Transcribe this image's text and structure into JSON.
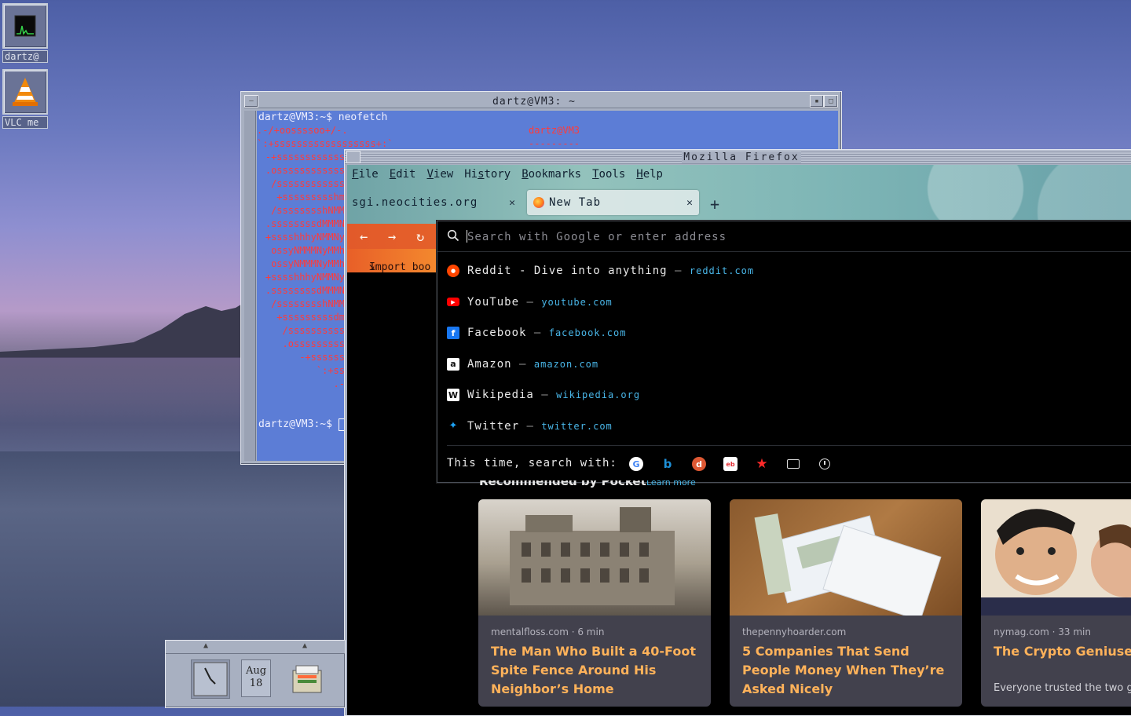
{
  "desktop": {
    "icons": [
      {
        "label": "dartz@",
        "icon": "system-monitor-icon"
      },
      {
        "label": "VLC me",
        "icon": "vlc-cone-icon"
      }
    ]
  },
  "terminal": {
    "title": "dartz@VM3: ~",
    "line1": "dartz@VM3:~$ neofetch",
    "user_host": "dartz@VM3",
    "underline": "---------",
    "last_prompt": "dartz@VM3:~$ ",
    "art": [
      ".-/+oossssoo+/-.",
      "`:+ssssssssssssssssss+:`",
      "-+ssssssssssss",
      ".ossssssssssss",
      "/ssssssssssss",
      "+ssssssssshm",
      "/sssssssshNMM",
      ".ssssssssdMMMN",
      "+sssshhhyNMMNy",
      "ossyNMMMNyMMh",
      "ossyNMMMNyMMh",
      "+sssshhhyNMMNy",
      ".ssssssssdMMMN",
      "/sssssssshNMM",
      "+sssssssssdm",
      "/ssssssssss",
      ".osssssssss",
      "-+ssssss",
      "`:+ss",
      ".-"
    ]
  },
  "firefox": {
    "title": "Mozilla Firefox",
    "menu": [
      {
        "label": "File",
        "u": "F",
        "rest": "ile"
      },
      {
        "label": "Edit",
        "u": "E",
        "rest": "dit"
      },
      {
        "label": "View",
        "u": "V",
        "rest": "iew"
      },
      {
        "label": "History",
        "pre": "Hi",
        "u": "s",
        "rest": "tory"
      },
      {
        "label": "Bookmarks",
        "u": "B",
        "rest": "ookmarks"
      },
      {
        "label": "Tools",
        "u": "T",
        "rest": "ools"
      },
      {
        "label": "Help",
        "u": "H",
        "rest": "elp"
      }
    ],
    "tabs": [
      {
        "label": "sgi.neocities.org",
        "active": false
      },
      {
        "label": "New Tab",
        "active": true
      }
    ],
    "import_bookmarks": "Import boo",
    "url": {
      "placeholder": "Search with Google or enter address",
      "value": ""
    },
    "suggestions": [
      {
        "title": "Reddit - Dive into anything",
        "url": "reddit.com",
        "icon": "reddit-icon",
        "color": "#ff4500"
      },
      {
        "title": "YouTube",
        "url": "youtube.com",
        "icon": "youtube-icon",
        "color": "#ff0000"
      },
      {
        "title": "Facebook",
        "url": "facebook.com",
        "icon": "facebook-icon",
        "color": "#1877f2"
      },
      {
        "title": "Amazon",
        "url": "amazon.com",
        "icon": "amazon-icon",
        "color": "#ffffff"
      },
      {
        "title": "Wikipedia",
        "url": "wikipedia.org",
        "icon": "wikipedia-icon",
        "color": "#ffffff"
      },
      {
        "title": "Twitter",
        "url": "twitter.com",
        "icon": "twitter-icon",
        "color": "#1da1f2"
      }
    ],
    "search_with_label": "This time, search with:",
    "engines": [
      "google-icon",
      "bing-icon",
      "duckduckgo-icon",
      "ebay-icon",
      "bookmarks-star-icon",
      "tabs-icon",
      "history-icon"
    ],
    "pocket": {
      "heading": "Recommended by Pocket",
      "learn_more": "Learn more",
      "cards": [
        {
          "source": "mentalfloss.com · 6 min",
          "title": "The Man Who Built a 40-Foot Spite Fence Around His Neighbor’s Home",
          "excerpt": ""
        },
        {
          "source": "thepennyhoarder.com",
          "title": "5 Companies That Send People Money When They’re Asked Nicely",
          "excerpt": ""
        },
        {
          "source": "nymag.com · 33 min",
          "title": "The Crypto Geniuses Who Vaporized a Trillion Dollars",
          "excerpt": "Everyone trusted the two guys at Three Arrows Capital. They knew"
        }
      ]
    }
  },
  "dock": {
    "calendar_month": "Aug",
    "calendar_day": "18"
  }
}
